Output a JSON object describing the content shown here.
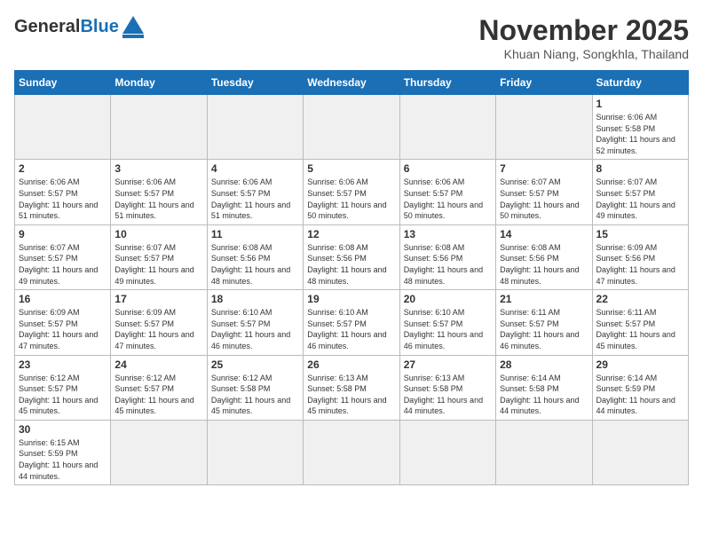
{
  "header": {
    "logo_general": "General",
    "logo_blue": "Blue",
    "month_title": "November 2025",
    "location": "Khuan Niang, Songkhla, Thailand"
  },
  "weekdays": [
    "Sunday",
    "Monday",
    "Tuesday",
    "Wednesday",
    "Thursday",
    "Friday",
    "Saturday"
  ],
  "days": [
    {
      "date": "",
      "sunrise": "",
      "sunset": "",
      "daylight": ""
    },
    {
      "date": "",
      "sunrise": "",
      "sunset": "",
      "daylight": ""
    },
    {
      "date": "",
      "sunrise": "",
      "sunset": "",
      "daylight": ""
    },
    {
      "date": "",
      "sunrise": "",
      "sunset": "",
      "daylight": ""
    },
    {
      "date": "",
      "sunrise": "",
      "sunset": "",
      "daylight": ""
    },
    {
      "date": "",
      "sunrise": "",
      "sunset": "",
      "daylight": ""
    },
    {
      "date": "1",
      "sunrise": "Sunrise: 6:06 AM",
      "sunset": "Sunset: 5:58 PM",
      "daylight": "Daylight: 11 hours and 52 minutes."
    },
    {
      "date": "2",
      "sunrise": "Sunrise: 6:06 AM",
      "sunset": "Sunset: 5:57 PM",
      "daylight": "Daylight: 11 hours and 51 minutes."
    },
    {
      "date": "3",
      "sunrise": "Sunrise: 6:06 AM",
      "sunset": "Sunset: 5:57 PM",
      "daylight": "Daylight: 11 hours and 51 minutes."
    },
    {
      "date": "4",
      "sunrise": "Sunrise: 6:06 AM",
      "sunset": "Sunset: 5:57 PM",
      "daylight": "Daylight: 11 hours and 51 minutes."
    },
    {
      "date": "5",
      "sunrise": "Sunrise: 6:06 AM",
      "sunset": "Sunset: 5:57 PM",
      "daylight": "Daylight: 11 hours and 50 minutes."
    },
    {
      "date": "6",
      "sunrise": "Sunrise: 6:06 AM",
      "sunset": "Sunset: 5:57 PM",
      "daylight": "Daylight: 11 hours and 50 minutes."
    },
    {
      "date": "7",
      "sunrise": "Sunrise: 6:07 AM",
      "sunset": "Sunset: 5:57 PM",
      "daylight": "Daylight: 11 hours and 50 minutes."
    },
    {
      "date": "8",
      "sunrise": "Sunrise: 6:07 AM",
      "sunset": "Sunset: 5:57 PM",
      "daylight": "Daylight: 11 hours and 49 minutes."
    },
    {
      "date": "9",
      "sunrise": "Sunrise: 6:07 AM",
      "sunset": "Sunset: 5:57 PM",
      "daylight": "Daylight: 11 hours and 49 minutes."
    },
    {
      "date": "10",
      "sunrise": "Sunrise: 6:07 AM",
      "sunset": "Sunset: 5:57 PM",
      "daylight": "Daylight: 11 hours and 49 minutes."
    },
    {
      "date": "11",
      "sunrise": "Sunrise: 6:08 AM",
      "sunset": "Sunset: 5:56 PM",
      "daylight": "Daylight: 11 hours and 48 minutes."
    },
    {
      "date": "12",
      "sunrise": "Sunrise: 6:08 AM",
      "sunset": "Sunset: 5:56 PM",
      "daylight": "Daylight: 11 hours and 48 minutes."
    },
    {
      "date": "13",
      "sunrise": "Sunrise: 6:08 AM",
      "sunset": "Sunset: 5:56 PM",
      "daylight": "Daylight: 11 hours and 48 minutes."
    },
    {
      "date": "14",
      "sunrise": "Sunrise: 6:08 AM",
      "sunset": "Sunset: 5:56 PM",
      "daylight": "Daylight: 11 hours and 48 minutes."
    },
    {
      "date": "15",
      "sunrise": "Sunrise: 6:09 AM",
      "sunset": "Sunset: 5:56 PM",
      "daylight": "Daylight: 11 hours and 47 minutes."
    },
    {
      "date": "16",
      "sunrise": "Sunrise: 6:09 AM",
      "sunset": "Sunset: 5:57 PM",
      "daylight": "Daylight: 11 hours and 47 minutes."
    },
    {
      "date": "17",
      "sunrise": "Sunrise: 6:09 AM",
      "sunset": "Sunset: 5:57 PM",
      "daylight": "Daylight: 11 hours and 47 minutes."
    },
    {
      "date": "18",
      "sunrise": "Sunrise: 6:10 AM",
      "sunset": "Sunset: 5:57 PM",
      "daylight": "Daylight: 11 hours and 46 minutes."
    },
    {
      "date": "19",
      "sunrise": "Sunrise: 6:10 AM",
      "sunset": "Sunset: 5:57 PM",
      "daylight": "Daylight: 11 hours and 46 minutes."
    },
    {
      "date": "20",
      "sunrise": "Sunrise: 6:10 AM",
      "sunset": "Sunset: 5:57 PM",
      "daylight": "Daylight: 11 hours and 46 minutes."
    },
    {
      "date": "21",
      "sunrise": "Sunrise: 6:11 AM",
      "sunset": "Sunset: 5:57 PM",
      "daylight": "Daylight: 11 hours and 46 minutes."
    },
    {
      "date": "22",
      "sunrise": "Sunrise: 6:11 AM",
      "sunset": "Sunset: 5:57 PM",
      "daylight": "Daylight: 11 hours and 45 minutes."
    },
    {
      "date": "23",
      "sunrise": "Sunrise: 6:12 AM",
      "sunset": "Sunset: 5:57 PM",
      "daylight": "Daylight: 11 hours and 45 minutes."
    },
    {
      "date": "24",
      "sunrise": "Sunrise: 6:12 AM",
      "sunset": "Sunset: 5:57 PM",
      "daylight": "Daylight: 11 hours and 45 minutes."
    },
    {
      "date": "25",
      "sunrise": "Sunrise: 6:12 AM",
      "sunset": "Sunset: 5:58 PM",
      "daylight": "Daylight: 11 hours and 45 minutes."
    },
    {
      "date": "26",
      "sunrise": "Sunrise: 6:13 AM",
      "sunset": "Sunset: 5:58 PM",
      "daylight": "Daylight: 11 hours and 45 minutes."
    },
    {
      "date": "27",
      "sunrise": "Sunrise: 6:13 AM",
      "sunset": "Sunset: 5:58 PM",
      "daylight": "Daylight: 11 hours and 44 minutes."
    },
    {
      "date": "28",
      "sunrise": "Sunrise: 6:14 AM",
      "sunset": "Sunset: 5:58 PM",
      "daylight": "Daylight: 11 hours and 44 minutes."
    },
    {
      "date": "29",
      "sunrise": "Sunrise: 6:14 AM",
      "sunset": "Sunset: 5:59 PM",
      "daylight": "Daylight: 11 hours and 44 minutes."
    },
    {
      "date": "30",
      "sunrise": "Sunrise: 6:15 AM",
      "sunset": "Sunset: 5:59 PM",
      "daylight": "Daylight: 11 hours and 44 minutes."
    },
    {
      "date": "",
      "sunrise": "",
      "sunset": "",
      "daylight": ""
    },
    {
      "date": "",
      "sunrise": "",
      "sunset": "",
      "daylight": ""
    },
    {
      "date": "",
      "sunrise": "",
      "sunset": "",
      "daylight": ""
    },
    {
      "date": "",
      "sunrise": "",
      "sunset": "",
      "daylight": ""
    },
    {
      "date": "",
      "sunrise": "",
      "sunset": "",
      "daylight": ""
    },
    {
      "date": "",
      "sunrise": "",
      "sunset": "",
      "daylight": ""
    }
  ]
}
